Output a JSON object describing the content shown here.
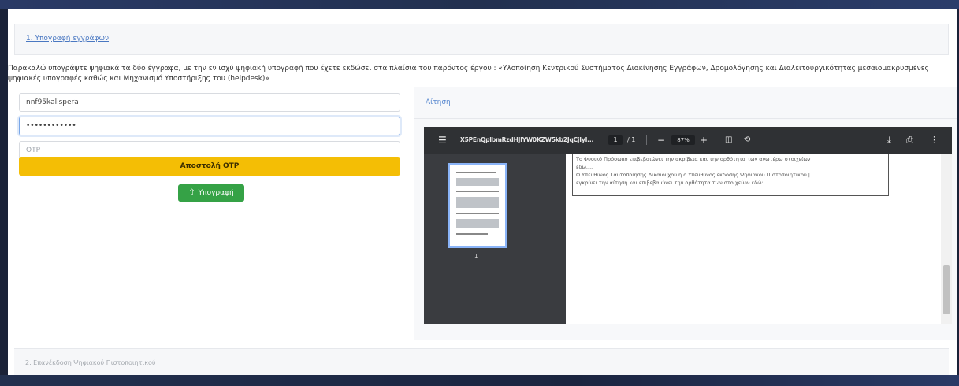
{
  "steps": {
    "step1_label": "1. Υπογραφή εγγράφων",
    "step2_label": "2. Επανέκδοση Ψηφιακού Πιστοποιητικού"
  },
  "instructions": "Παρακαλώ υπογράψτε ψηφιακά τα δύο έγγραφα, με την εν ισχύ ψηφιακή υπογραφή που έχετε εκδώσει στα πλαίσια του παρόντος έργου : «Υλοποίηση Κεντρικού Συστήματος Διακίνησης Εγγράφων, Δρομολόγησης και Διαλειτουργικότητας μεσαιομακρυσμένες ψηφιακές υπογραφές καθώς και Μηχανισμό Υποστήριξης του (helpdesk)»",
  "form": {
    "username_value": "nnf95kalispera",
    "password_value": "••••••••••••",
    "otp_placeholder": "OTP",
    "send_otp_label": "Αποστολή OTP",
    "sign_label": "Υπογραφή"
  },
  "aitisi": {
    "header_label": "Αίτηση"
  },
  "viewer": {
    "doc_title": "X5PEnQpIbmRzdHJlYW0KZW5kb2JqCjIyI...",
    "current_page": "1",
    "total_pages": "/ 1",
    "zoom": "87%",
    "thumb_page_number": "1",
    "doc_lines": [
      "Το Φυσικό Πρόσωπο επιβεβαιώνει την ακρίβεια και την ορθότητα των ανωτέρω στοιχείων",
      "εδώ....",
      "Ο Υπεύθυνος Ταυτοποίησης Δικαιούχου ή ο Υπεύθυνος έκδοσης Ψηφιακού Πιστοποιητικού |",
      "εγκρίνει την αίτηση και επιβεβαιώνει την ορθότητα των στοιχείων εδώ:"
    ]
  },
  "colors": {
    "otp_button": "#f4be05",
    "sign_button": "#35a246",
    "link": "#4a78c2",
    "viewer_toolbar": "#2f3134"
  }
}
